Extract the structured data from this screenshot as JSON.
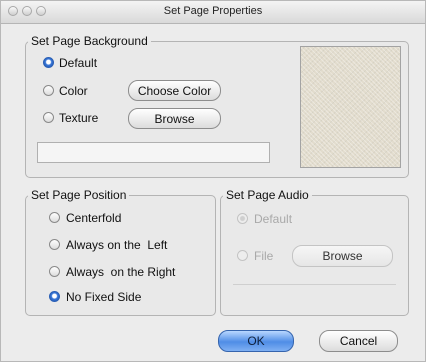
{
  "window": {
    "title": "Set Page Properties"
  },
  "background_group": {
    "legend": "Set Page Background",
    "options": [
      {
        "label": "Default",
        "selected": true
      },
      {
        "label": "Color",
        "selected": false
      },
      {
        "label": "Texture",
        "selected": false
      }
    ],
    "choose_color_label": "Choose Color",
    "browse_label": "Browse",
    "texture_path_value": ""
  },
  "position_group": {
    "legend": "Set Page Position",
    "options": [
      {
        "label": "Centerfold",
        "selected": false
      },
      {
        "label": "Always on the  Left",
        "selected": false
      },
      {
        "label": "Always  on the Right",
        "selected": false
      },
      {
        "label": "No Fixed Side",
        "selected": true
      }
    ]
  },
  "audio_group": {
    "legend": "Set Page Audio",
    "enabled": false,
    "options": [
      {
        "label": "Default",
        "selected": true
      },
      {
        "label": "File",
        "selected": false
      }
    ],
    "browse_label": "Browse"
  },
  "footer": {
    "ok_label": "OK",
    "cancel_label": "Cancel"
  }
}
